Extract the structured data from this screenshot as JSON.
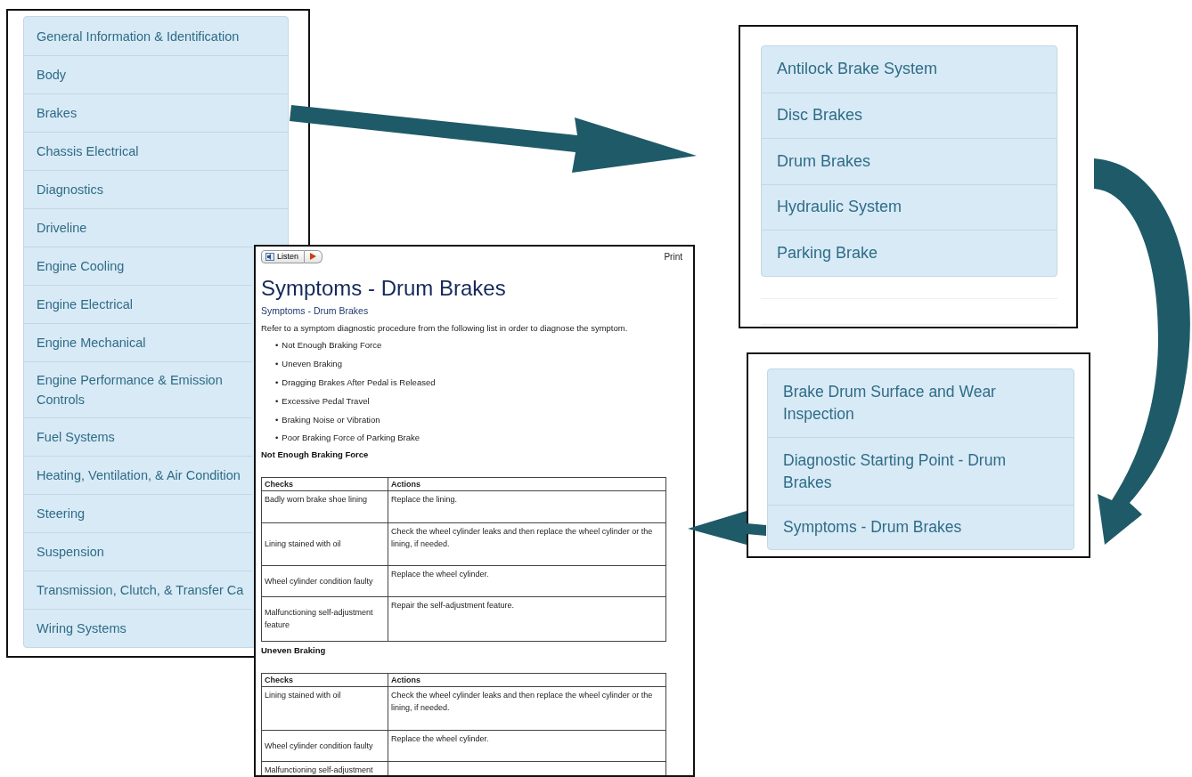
{
  "categories": [
    {
      "label": "General Information & Identification"
    },
    {
      "label": "Body"
    },
    {
      "label": "Brakes"
    },
    {
      "label": "Chassis Electrical"
    },
    {
      "label": "Diagnostics"
    },
    {
      "label": "Driveline"
    },
    {
      "label": "Engine Cooling"
    },
    {
      "label": "Engine Electrical"
    },
    {
      "label": "Engine Mechanical"
    },
    {
      "label": "Engine Performance & Emission Controls"
    },
    {
      "label": "Fuel Systems"
    },
    {
      "label": "Heating, Ventilation, & Air Condition"
    },
    {
      "label": "Steering"
    },
    {
      "label": "Suspension"
    },
    {
      "label": "Transmission, Clutch, & Transfer Ca"
    },
    {
      "label": "Wiring Systems"
    }
  ],
  "subcategories": [
    {
      "label": "Antilock Brake System"
    },
    {
      "label": "Disc Brakes"
    },
    {
      "label": "Drum Brakes"
    },
    {
      "label": "Hydraulic System"
    },
    {
      "label": "Parking Brake"
    }
  ],
  "procedures": [
    {
      "label": "Brake Drum Surface and Wear Inspection"
    },
    {
      "label": "Diagnostic Starting Point - Drum Brakes"
    },
    {
      "label": "Symptoms - Drum Brakes"
    }
  ],
  "document": {
    "bullet": "•",
    "listen_button": "Listen",
    "print_link": "Print",
    "title": "Symptoms - Drum Brakes",
    "breadcrumb": "Symptoms - Drum Brakes",
    "intro": "Refer to a symptom diagnostic procedure from the following list in order to diagnose the symptom.",
    "symptoms": [
      "Not Enough Braking Force",
      "Uneven Braking",
      "Dragging Brakes After Pedal is Released",
      "Excessive Pedal Travel",
      "Braking Noise or Vibration",
      "Poor Braking Force of Parking Brake"
    ],
    "sections": [
      {
        "heading": "Not Enough Braking Force",
        "columns": [
          "Checks",
          "Actions"
        ],
        "rows": [
          {
            "check": "Badly worn brake shoe lining",
            "action": "Replace the lining."
          },
          {
            "check": "Lining stained with oil",
            "action": "Check the wheel cylinder leaks and then replace the wheel cylinder or the lining, if needed."
          },
          {
            "check": "Wheel cylinder condition faulty",
            "action": "Replace the wheel cylinder."
          },
          {
            "check": "Malfunctioning self-adjustment feature",
            "action": "Repair the self-adjustment feature."
          }
        ]
      },
      {
        "heading": "Uneven Braking",
        "columns": [
          "Checks",
          "Actions"
        ],
        "rows": [
          {
            "check": "Lining stained with oil",
            "action": "Check the wheel cylinder leaks and then replace the wheel cylinder or the lining, if needed."
          },
          {
            "check": "Wheel cylinder condition faulty",
            "action": "Replace the wheel cylinder."
          },
          {
            "check": "Malfunctioning self-adjustment"
          }
        ]
      }
    ]
  }
}
